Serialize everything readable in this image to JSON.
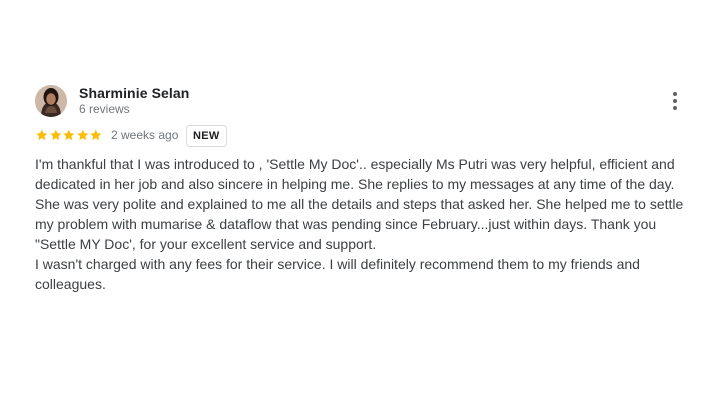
{
  "reviewer": {
    "name": "Sharminie Selan",
    "reviews_count": "6 reviews",
    "avatar_icon": "profile-photo"
  },
  "rating": {
    "stars": 5,
    "max": 5,
    "star_color": "#fbbc04"
  },
  "date": "2 weeks ago",
  "badge": "NEW",
  "review_text": [
    "I'm thankful that I was introduced to , 'Settle My Doc'.. especially Ms Putri was very helpful, efficient and dedicated in her job and also sincere in helping me. She replies to my messages at any time of the day. She was very polite and explained to me all the details and steps that asked her. She helped me to settle my problem with mumarise & dataflow that was pending since February...just within days. Thank you \"Settle MY Doc', for your excellent service and support.",
    "I wasn't charged with any fees for their service. I will definitely recommend them to my friends and colleagues."
  ],
  "menu_icon": "more-vertical-icon"
}
